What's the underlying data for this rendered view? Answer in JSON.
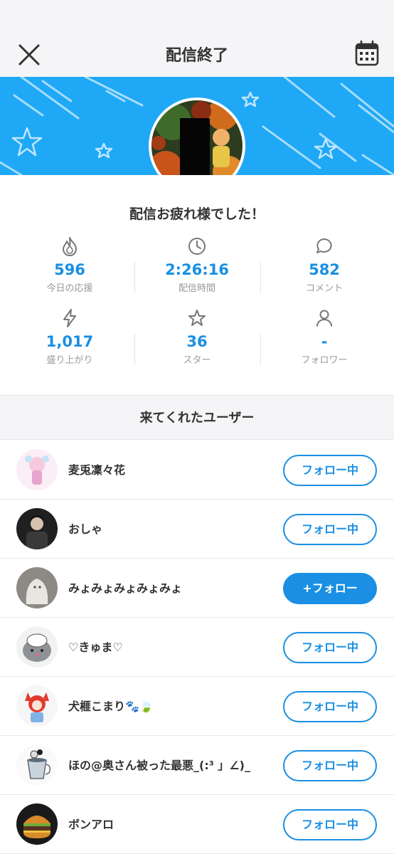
{
  "header": {
    "title": "配信終了"
  },
  "summary": {
    "thanks": "配信お疲れ様でした！",
    "stats": [
      {
        "icon": "flame-icon",
        "value": "596",
        "label": "今日の応援"
      },
      {
        "icon": "clock-icon",
        "value": "2:26:16",
        "label": "配信時間"
      },
      {
        "icon": "comment-icon",
        "value": "582",
        "label": "コメント"
      },
      {
        "icon": "lightning-icon",
        "value": "1,017",
        "label": "盛り上がり"
      },
      {
        "icon": "star-icon",
        "value": "36",
        "label": "スター"
      },
      {
        "icon": "person-icon",
        "value": "-",
        "label": "フォロワー"
      }
    ]
  },
  "visitors": {
    "title": "来てくれたユーザー",
    "users": [
      {
        "name": "麦兎凜々花",
        "button": "フォロー中"
      },
      {
        "name": "おしゃ",
        "button": "フォロー中"
      },
      {
        "name": "みょみょみょみょみょ",
        "button": "+フォロー"
      },
      {
        "name": "♡きゅま♡",
        "button": "フォロー中"
      },
      {
        "name": "犬榧こまり🐾🍃",
        "button": "フォロー中"
      },
      {
        "name": "ほの@奥さん被った最悪_(:³ 」∠)_",
        "button": "フォロー中"
      },
      {
        "name": "ボンアロ",
        "button": "フォロー中"
      }
    ]
  },
  "colors": {
    "accent": "#1a8fe3",
    "banner": "#1fa8f5",
    "background": "#f5f5f7"
  }
}
